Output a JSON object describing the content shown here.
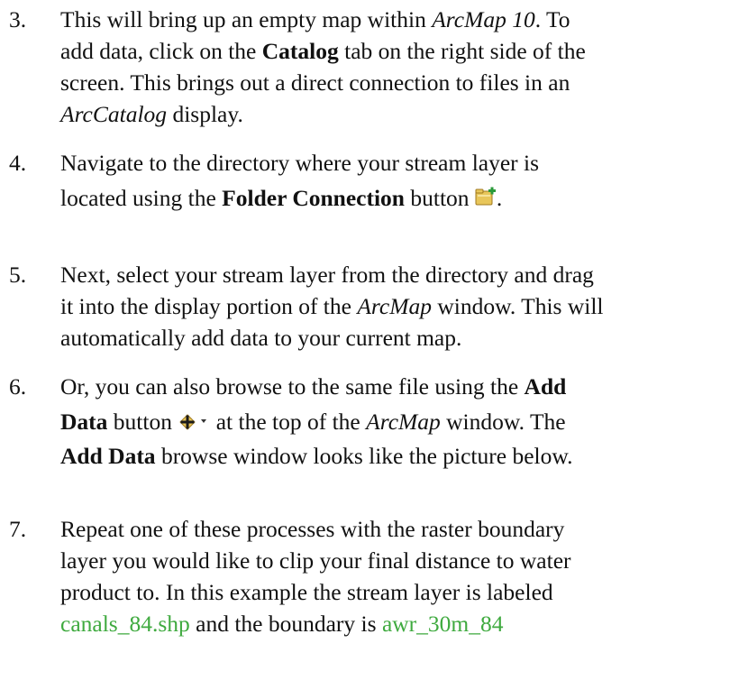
{
  "steps": [
    {
      "number": "3.",
      "l1": "This will bring up an empty map within ",
      "l1_em": "ArcMap 10",
      "l1_end": ". To",
      "l2_a": "add data, click on the ",
      "l2_b": "Catalog",
      "l2_c": " tab on the right side of the",
      "l3": "screen. This brings out a direct connection to files in an",
      "l4_em": "ArcCatalog",
      "l4_end": " display."
    },
    {
      "number": "4.",
      "l1": "Navigate to the directory where your stream layer is",
      "l2_a": "located using the ",
      "l2_b": "Folder Connection",
      "l2_c": " button ",
      "l2_end": ".",
      "icon": "folder-connection-icon"
    },
    {
      "number": "5.",
      "l1": "Next, select your stream layer from the directory and drag",
      "l2_a": "it into the display portion of the ",
      "l2_em": "ArcMap",
      "l2_c": " window. This will",
      "l3": "automatically add data to your current map."
    },
    {
      "number": "6.",
      "l1_a": "Or, you can also browse to the same file using the ",
      "l1_b": "Add",
      "l2_b": "Data",
      "l2_c": " button ",
      "l2_d": " at the top of the ",
      "l2_em": "ArcMap",
      "l2_e": " window. The",
      "l3_b": "Add Data",
      "l3_c": " browse window looks like the picture below.",
      "icon": "add-data-icon"
    },
    {
      "number": "7.",
      "l1": "Repeat one of these processes with the raster boundary",
      "l2": "layer you would like to clip your final distance to water",
      "l3": "product to. In this example the stream layer is labeled",
      "l4_a": "canals_84.shp",
      "l4_b": " and the boundary is ",
      "l4_c": "awr_30m_84"
    }
  ],
  "colors": {
    "text": "#111111",
    "highlight": "#3faa3f",
    "icon_folder": "#e8c65a",
    "icon_plus": "#2a9a3a"
  }
}
